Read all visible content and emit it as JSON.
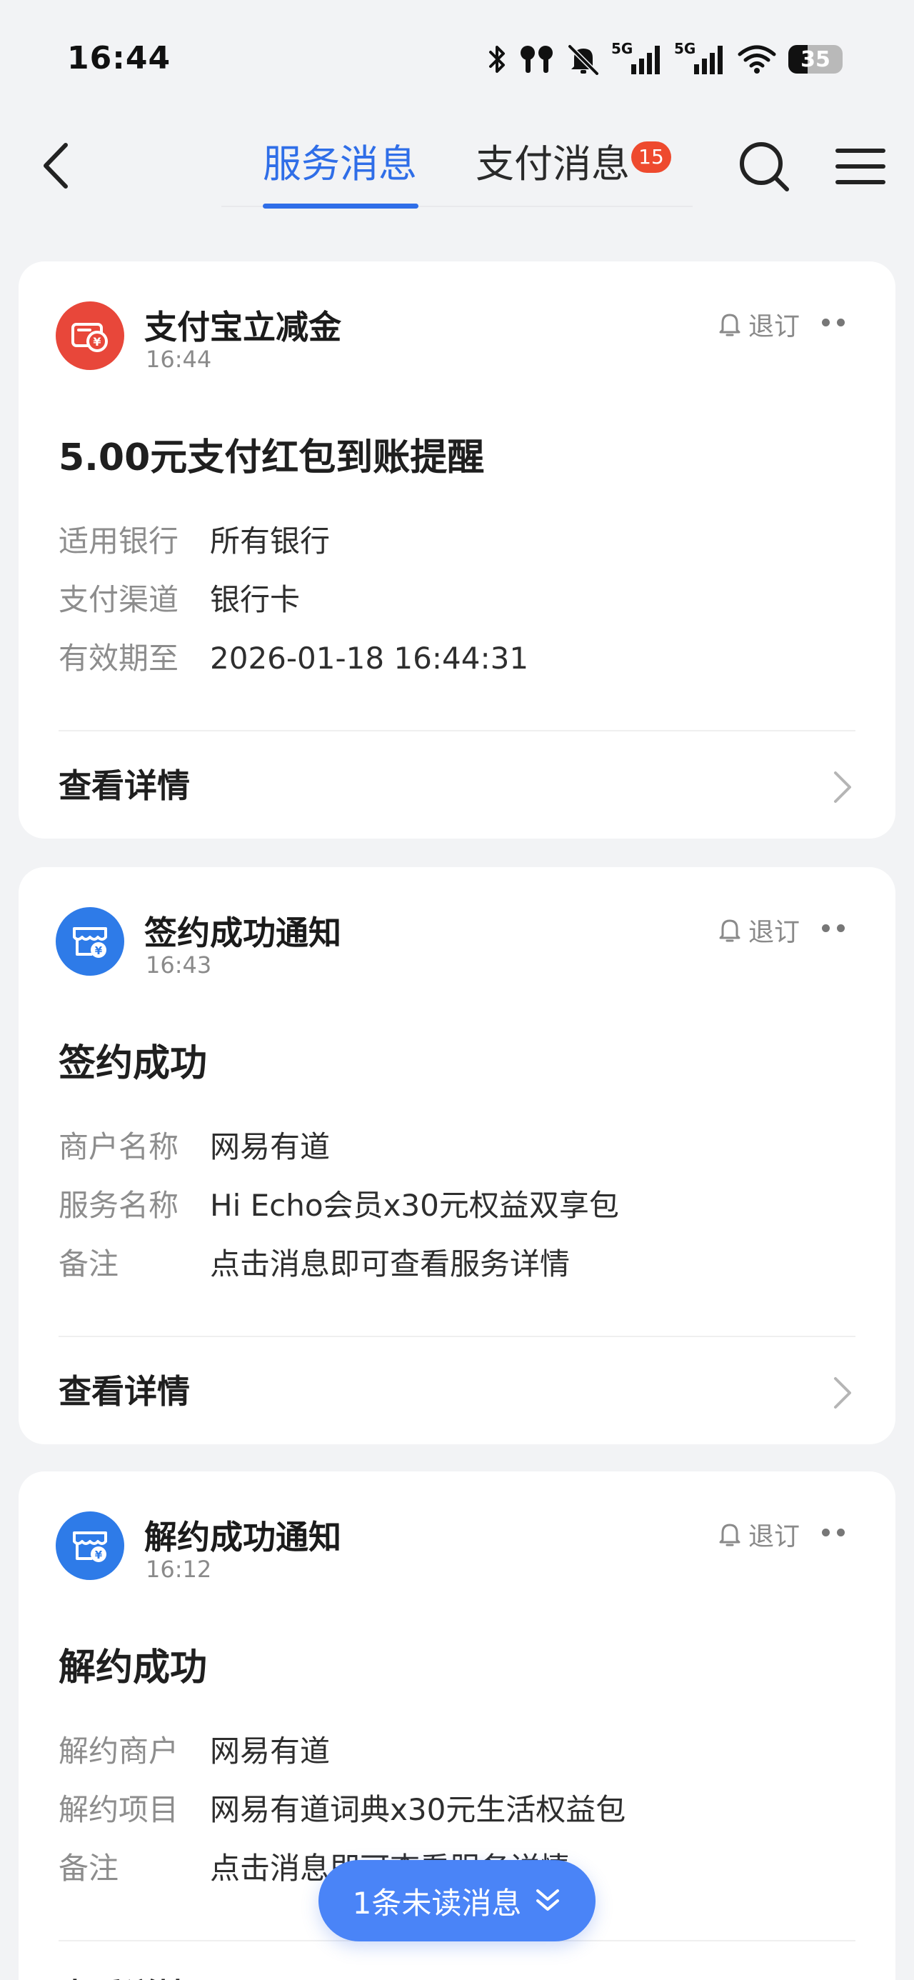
{
  "status_bar": {
    "time": "16:44",
    "battery": "35",
    "battery_level": 0.35,
    "network_label_1": "5G",
    "network_label_2": "5G",
    "icons": [
      "bluetooth-icon",
      "earbuds-icon",
      "muted-bell-icon",
      "signal-5g-icon",
      "signal-5g-icon",
      "wifi-icon",
      "battery-icon"
    ]
  },
  "nav": {
    "tab_service": "服务消息",
    "tab_payment": "支付消息",
    "payment_badge": "15",
    "active_tab": "服务消息"
  },
  "cards": [
    {
      "app_name": "支付宝立减金",
      "time": "16:44",
      "unsubscribe": "退订",
      "title": "5.00元支付红包到账提醒",
      "fields": [
        {
          "label": "适用银行",
          "value": "所有银行"
        },
        {
          "label": "支付渠道",
          "value": "银行卡"
        },
        {
          "label": "有效期至",
          "value": "2026-01-18 16:44:31"
        }
      ],
      "detail": "查看详情",
      "icon": "red-packet-icon",
      "icon_color": "#e8473a"
    },
    {
      "app_name": "签约成功通知",
      "time": "16:43",
      "unsubscribe": "退订",
      "title": "签约成功",
      "fields": [
        {
          "label": "商户名称",
          "value": "网易有道"
        },
        {
          "label": "服务名称",
          "value": "Hi Echo会员x30元权益双享包"
        },
        {
          "label": "备注",
          "value": "点击消息即可查看服务详情"
        }
      ],
      "detail": "查看详情",
      "icon": "contract-store-icon",
      "icon_color": "#2e7be8"
    },
    {
      "app_name": "解约成功通知",
      "time": "16:12",
      "unsubscribe": "退订",
      "title": "解约成功",
      "fields": [
        {
          "label": "解约商户",
          "value": "网易有道"
        },
        {
          "label": "解约项目",
          "value": "网易有道词典x30元生活权益包"
        },
        {
          "label": "备注",
          "value": "点击消息即可查看服务详情"
        }
      ],
      "detail": "查看详情",
      "icon": "contract-store-icon",
      "icon_color": "#2e7be8"
    }
  ],
  "unread_pill": {
    "label": "1条未读消息"
  },
  "colors": {
    "accent": "#2f6ee8",
    "badge": "#ee4a2e",
    "pill": "#4a84f7",
    "background": "#f2f3f5"
  }
}
